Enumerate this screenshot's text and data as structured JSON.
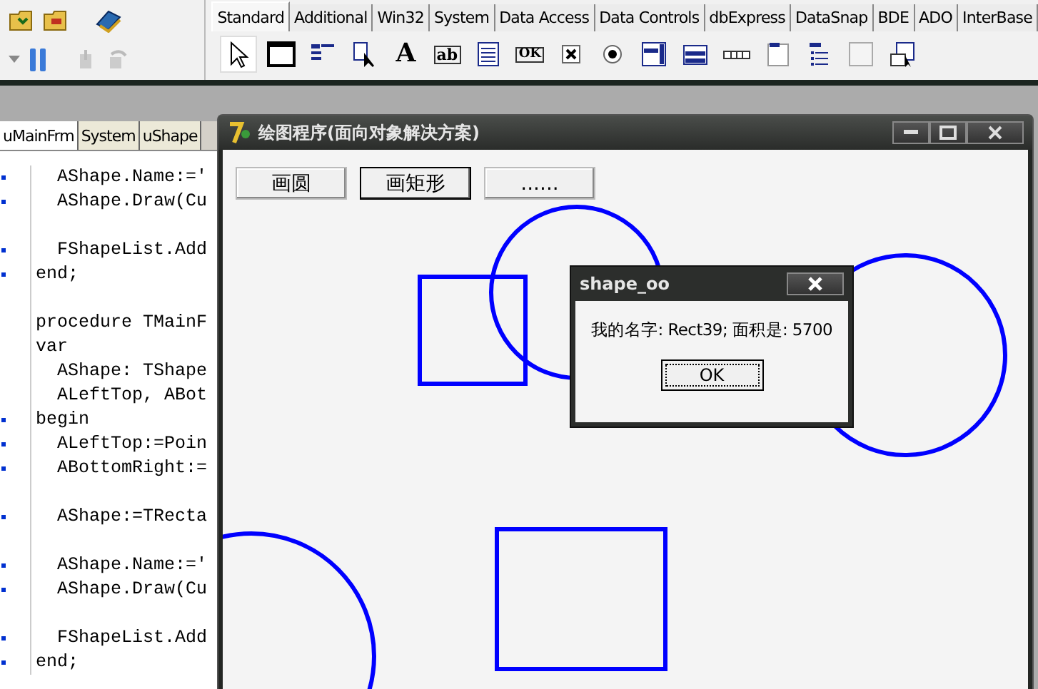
{
  "toolbar": {
    "palette_tabs": [
      {
        "label": "Standard",
        "selected": true
      },
      {
        "label": "Additional",
        "selected": false
      },
      {
        "label": "Win32",
        "selected": false
      },
      {
        "label": "System",
        "selected": false
      },
      {
        "label": "Data Access",
        "selected": false
      },
      {
        "label": "Data Controls",
        "selected": false
      },
      {
        "label": "dbExpress",
        "selected": false
      },
      {
        "label": "DataSnap",
        "selected": false
      },
      {
        "label": "BDE",
        "selected": false
      },
      {
        "label": "ADO",
        "selected": false
      },
      {
        "label": "InterBase",
        "selected": false
      }
    ],
    "components": [
      {
        "kind": "pointer",
        "selected": true
      },
      {
        "kind": "frame",
        "selected": false
      },
      {
        "kind": "mainmenu",
        "selected": false
      },
      {
        "kind": "popupmenu",
        "selected": false
      },
      {
        "kind": "glyph",
        "glyph": "A",
        "selected": false
      },
      {
        "kind": "edit",
        "glyph": "ab",
        "selected": false
      },
      {
        "kind": "memo",
        "selected": false
      },
      {
        "kind": "button",
        "glyph": "OK",
        "selected": false
      },
      {
        "kind": "checkbox",
        "selected": false
      },
      {
        "kind": "radio",
        "selected": false
      },
      {
        "kind": "listbox",
        "selected": false
      },
      {
        "kind": "combobox",
        "selected": false
      },
      {
        "kind": "scrollbar",
        "selected": false
      },
      {
        "kind": "groupbox",
        "selected": false
      },
      {
        "kind": "radiogroup",
        "selected": false
      },
      {
        "kind": "panel",
        "selected": false
      },
      {
        "kind": "actionlist",
        "selected": false
      }
    ]
  },
  "editor": {
    "tabs": [
      {
        "label": "uMainFrm",
        "selected": true
      },
      {
        "label": "System",
        "selected": false
      },
      {
        "label": "uShape",
        "selected": false
      }
    ],
    "lines": [
      {
        "text": "  AShape.Name:='",
        "breakpoint": true
      },
      {
        "text": "  AShape.Draw(Cu",
        "breakpoint": true
      },
      {
        "breakpoint": false
      },
      {
        "text": "  FShapeList.Add",
        "breakpoint": true
      },
      {
        "text": "end;",
        "breakpoint": true
      },
      {
        "breakpoint": false
      },
      {
        "text": "procedure TMainF",
        "breakpoint": false
      },
      {
        "text": "var",
        "breakpoint": false
      },
      {
        "text": "  AShape: TShape",
        "breakpoint": false
      },
      {
        "text": "  ALeftTop, ABot",
        "breakpoint": false
      },
      {
        "text": "begin",
        "breakpoint": true
      },
      {
        "text": "  ALeftTop:=Poin",
        "breakpoint": true
      },
      {
        "text": "  ABottomRight:=",
        "breakpoint": true
      },
      {
        "breakpoint": false
      },
      {
        "text": "  AShape:=TRecta",
        "breakpoint": true
      },
      {
        "breakpoint": false
      },
      {
        "text": "  AShape.Name:='",
        "breakpoint": true
      },
      {
        "text": "  AShape.Draw(Cu",
        "breakpoint": true
      },
      {
        "breakpoint": false
      },
      {
        "text": "  FShapeList.Add",
        "breakpoint": true
      },
      {
        "text": "end;",
        "breakpoint": true
      }
    ]
  },
  "form": {
    "title": "绘图程序(面向对象解决方案)",
    "buttons": [
      {
        "label": "画圆",
        "focused": false
      },
      {
        "label": "画矩形",
        "focused": true
      },
      {
        "label": "......",
        "focused": false
      }
    ]
  },
  "dialog": {
    "title": "shape_oo",
    "message": "我的名字: Rect39; 面积是: 5700",
    "button": "OK"
  }
}
